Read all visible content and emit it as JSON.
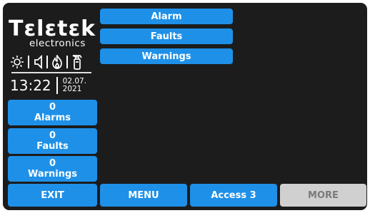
{
  "brand": {
    "name": "Tεlεtεk",
    "sub": "electronics"
  },
  "status_icons": [
    "sun-icon",
    "speaker-icon",
    "flame-icon",
    "extinguisher-icon"
  ],
  "clock": {
    "time": "13:22",
    "date_line1": "02.07.",
    "date_line2": "2021"
  },
  "top_tabs": [
    "Alarm",
    "Faults",
    "Warnings"
  ],
  "counters": [
    {
      "count": "0",
      "label": "Alarms"
    },
    {
      "count": "0",
      "label": "Faults"
    },
    {
      "count": "0",
      "label": "Warnings"
    }
  ],
  "bottom_bar": {
    "exit": "EXIT",
    "menu": "MENU",
    "access": "Access 3",
    "more": "MORE"
  },
  "colors": {
    "button": "#1e90e8",
    "disabled": "#d0d0d0",
    "screen": "#1c1c1c"
  }
}
